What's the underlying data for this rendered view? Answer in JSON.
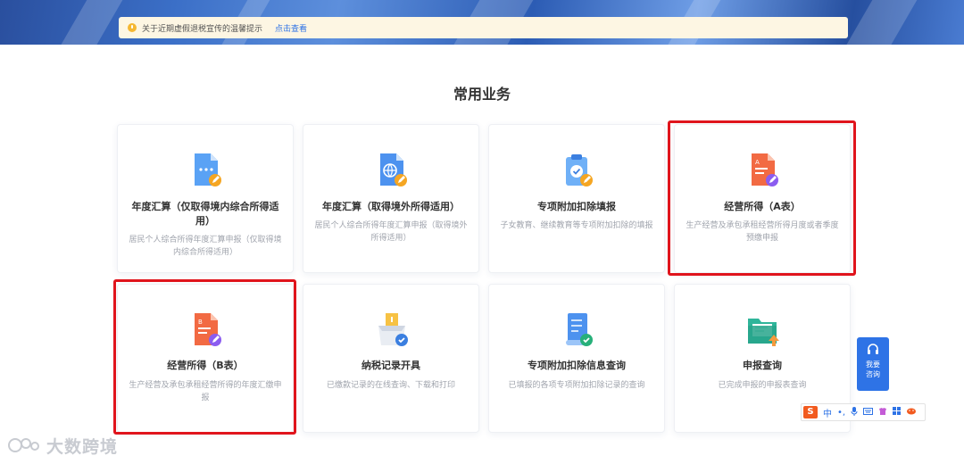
{
  "notice": {
    "text": "关于近期虚假退税宣传的温馨提示",
    "link": "点击查看"
  },
  "section_title": "常用业务",
  "cards": [
    {
      "title": "年度汇算（仅取得境内综合所得适用）",
      "desc": "居民个人综合所得年度汇算申报（仅取得境内综合所得适用）",
      "icon": "document-edit-icon"
    },
    {
      "title": "年度汇算（取得境外所得适用）",
      "desc": "居民个人综合所得年度汇算申报（取得境外所得适用）",
      "icon": "globe-document-icon"
    },
    {
      "title": "专项附加扣除填报",
      "desc": "子女教育、继续教育等专项附加扣除的填报",
      "icon": "clipboard-check-icon"
    },
    {
      "title": "经营所得（A表）",
      "desc": "生产经营及承包承租经营所得月度或者季度预缴申报",
      "icon": "document-a-icon"
    },
    {
      "title": "经营所得（B表）",
      "desc": "生产经营及承包承租经营所得的年度汇缴申报",
      "icon": "document-b-icon"
    },
    {
      "title": "纳税记录开具",
      "desc": "已缴款记录的在线查询、下载和打印",
      "icon": "certificate-box-icon"
    },
    {
      "title": "专项附加扣除信息查询",
      "desc": "已填报的各项专项附加扣除记录的查询",
      "icon": "scroll-check-icon"
    },
    {
      "title": "申报查询",
      "desc": "已完成申报的申报表查询",
      "icon": "folder-upload-icon"
    }
  ],
  "help": {
    "line1": "我要",
    "line2": "咨询"
  },
  "ime": {
    "logo": "S",
    "mode": "中"
  },
  "watermark": "大数跨境",
  "colors": {
    "primary": "#2e73e6",
    "highlight": "#e0141c",
    "notice_bg": "#fdf6e3"
  }
}
